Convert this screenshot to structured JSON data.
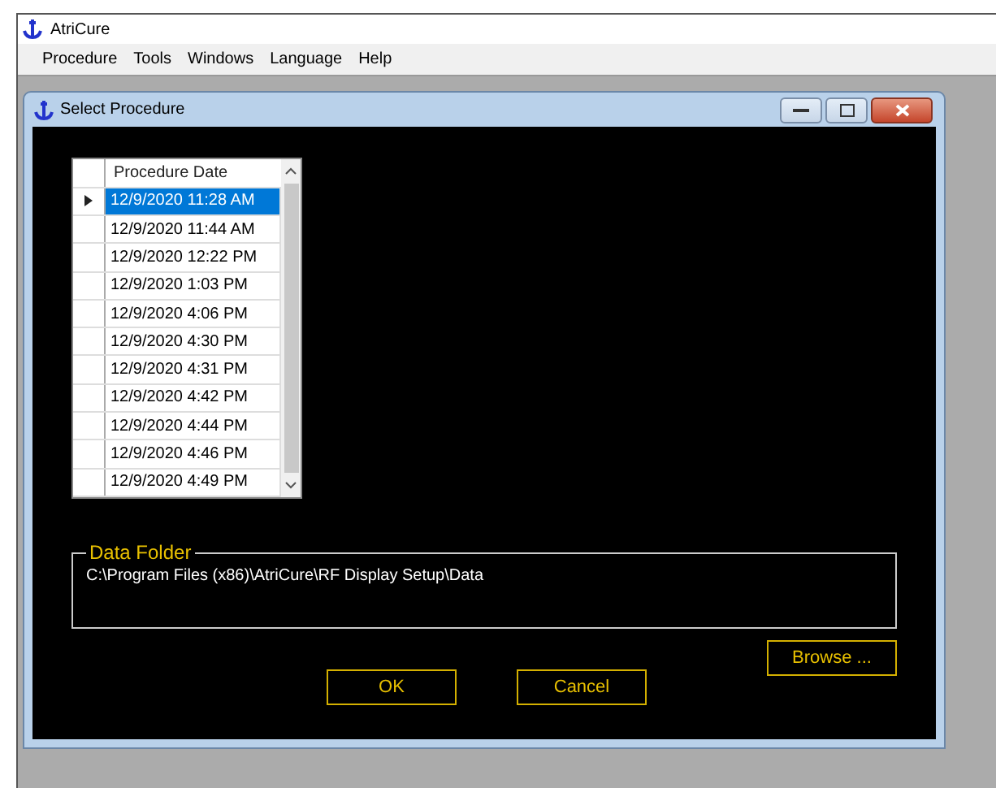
{
  "app_window": {
    "title": "AtriCure"
  },
  "menu": [
    "Procedure",
    "Tools",
    "Windows",
    "Language",
    "Help"
  ],
  "dialog": {
    "title": "Select Procedure",
    "table": {
      "columns": [
        "Procedure Date"
      ],
      "rows": [
        {
          "date": "12/9/2020 11:28 AM",
          "selected": true
        },
        {
          "date": "12/9/2020 11:44 AM",
          "selected": false
        },
        {
          "date": "12/9/2020 12:22 PM",
          "selected": false
        },
        {
          "date": "12/9/2020 1:03 PM",
          "selected": false
        },
        {
          "date": "12/9/2020 4:06 PM",
          "selected": false
        },
        {
          "date": "12/9/2020 4:30 PM",
          "selected": false
        },
        {
          "date": "12/9/2020 4:31 PM",
          "selected": false
        },
        {
          "date": "12/9/2020 4:42 PM",
          "selected": false
        },
        {
          "date": "12/9/2020 4:44 PM",
          "selected": false
        },
        {
          "date": "12/9/2020 4:46 PM",
          "selected": false
        },
        {
          "date": "12/9/2020 4:49 PM",
          "selected": false
        }
      ]
    },
    "data_folder": {
      "label": "Data Folder",
      "path": "C:\\Program Files (x86)\\AtriCure\\RF Display Setup\\Data"
    },
    "browse_button": "Browse ...",
    "buttons": [
      "OK",
      "Cancel"
    ]
  }
}
